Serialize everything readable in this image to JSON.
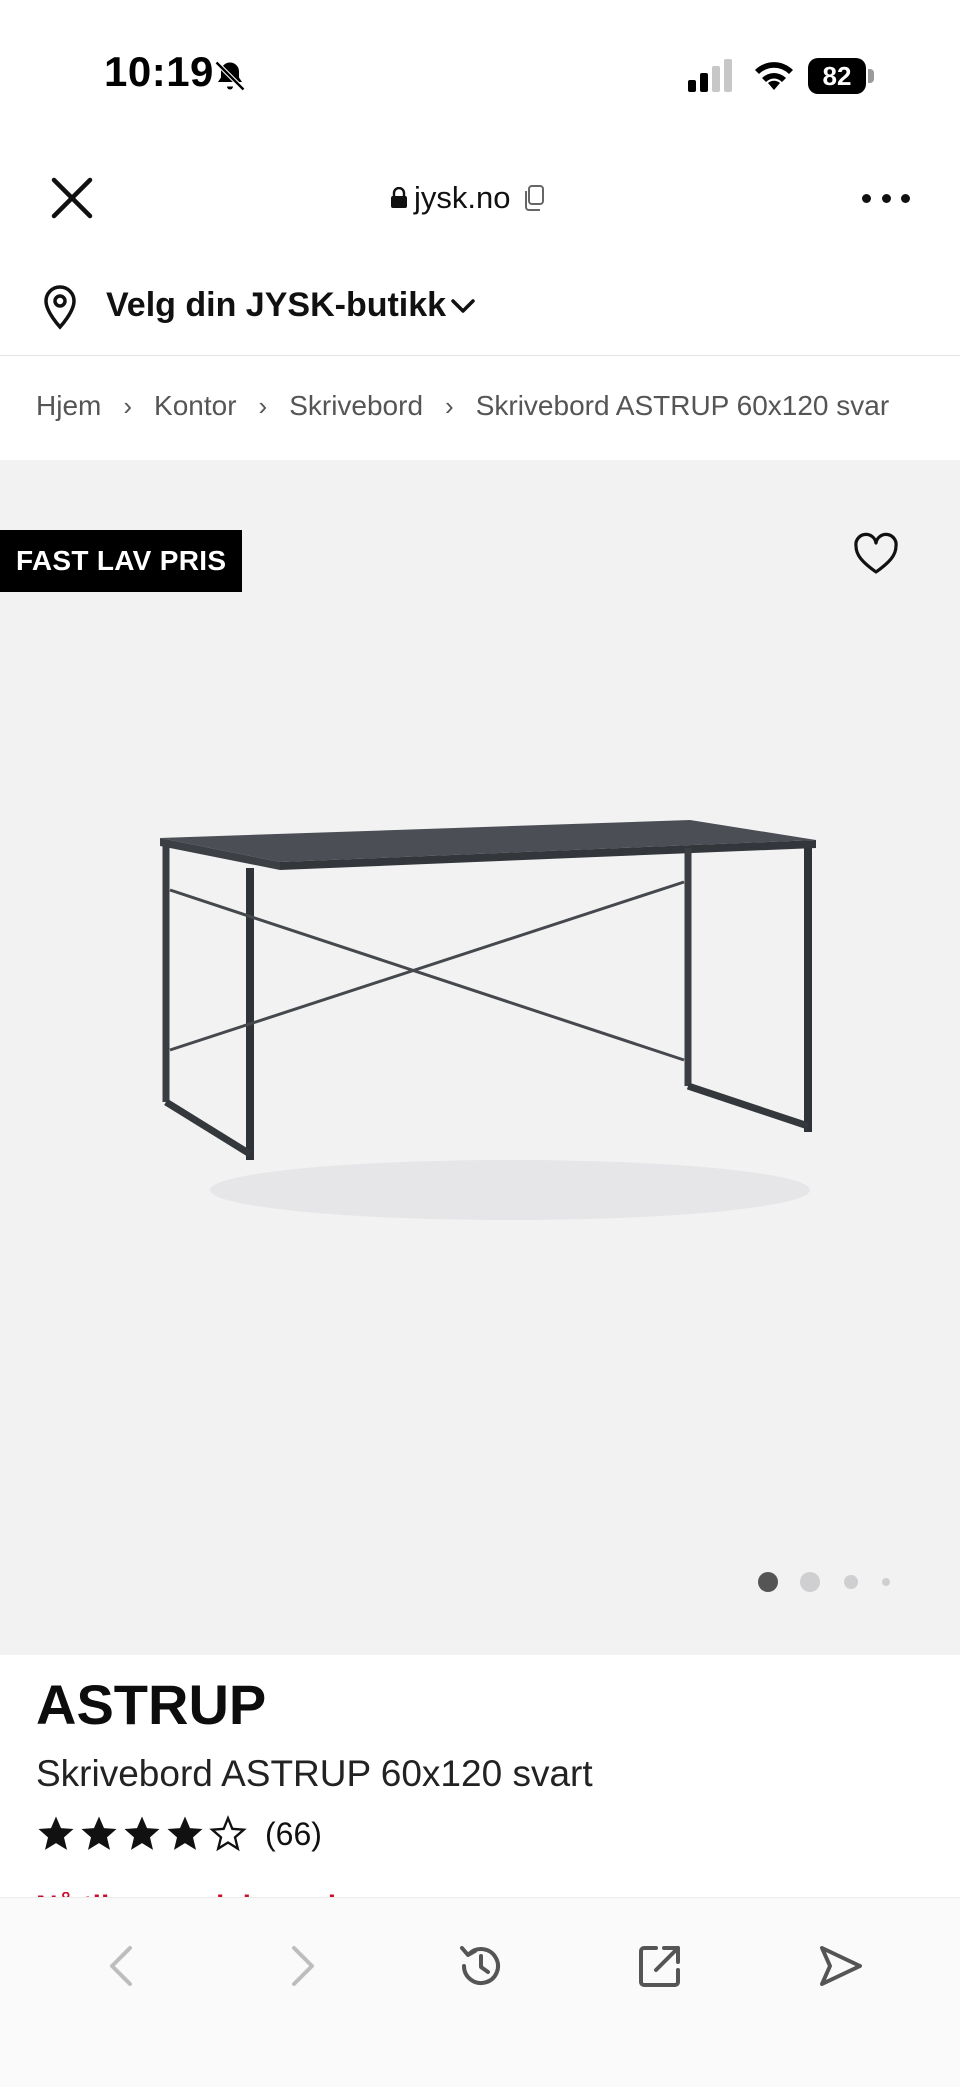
{
  "status_bar": {
    "time": "10:19",
    "battery": "82",
    "icons": [
      "bell-slash-icon",
      "signal-icon",
      "wifi-icon",
      "battery-icon"
    ]
  },
  "browser": {
    "url": "jysk.no",
    "icons": [
      "close-icon",
      "lock-icon",
      "copy-icon",
      "more-icon"
    ]
  },
  "store_selector": {
    "label": "Velg din JYSK-butikk",
    "icons": [
      "location-pin-icon",
      "chevron-down-icon"
    ]
  },
  "breadcrumb": {
    "items": [
      "Hjem",
      "Kontor",
      "Skrivebord",
      "Skrivebord ASTRUP 60x120 svar"
    ],
    "separator": "›"
  },
  "gallery": {
    "badge": "FAST LAV PRIS",
    "image_count": 4,
    "active_index": 0,
    "icons": [
      "heart-icon"
    ]
  },
  "product": {
    "brand": "ASTRUP",
    "name": "Skrivebord ASTRUP 60x120 svart",
    "rating": 4,
    "rating_max": 5,
    "review_count": "(66)"
  },
  "promo_cutoff": "Nå til og med desember",
  "bottom_toolbar": {
    "icons": [
      "back-icon",
      "forward-icon",
      "history-icon",
      "share-icon",
      "send-icon"
    ]
  },
  "colors": {
    "accent_red": "#c8102e",
    "badge_bg": "#000000",
    "gallery_bg": "#f2f2f3"
  }
}
